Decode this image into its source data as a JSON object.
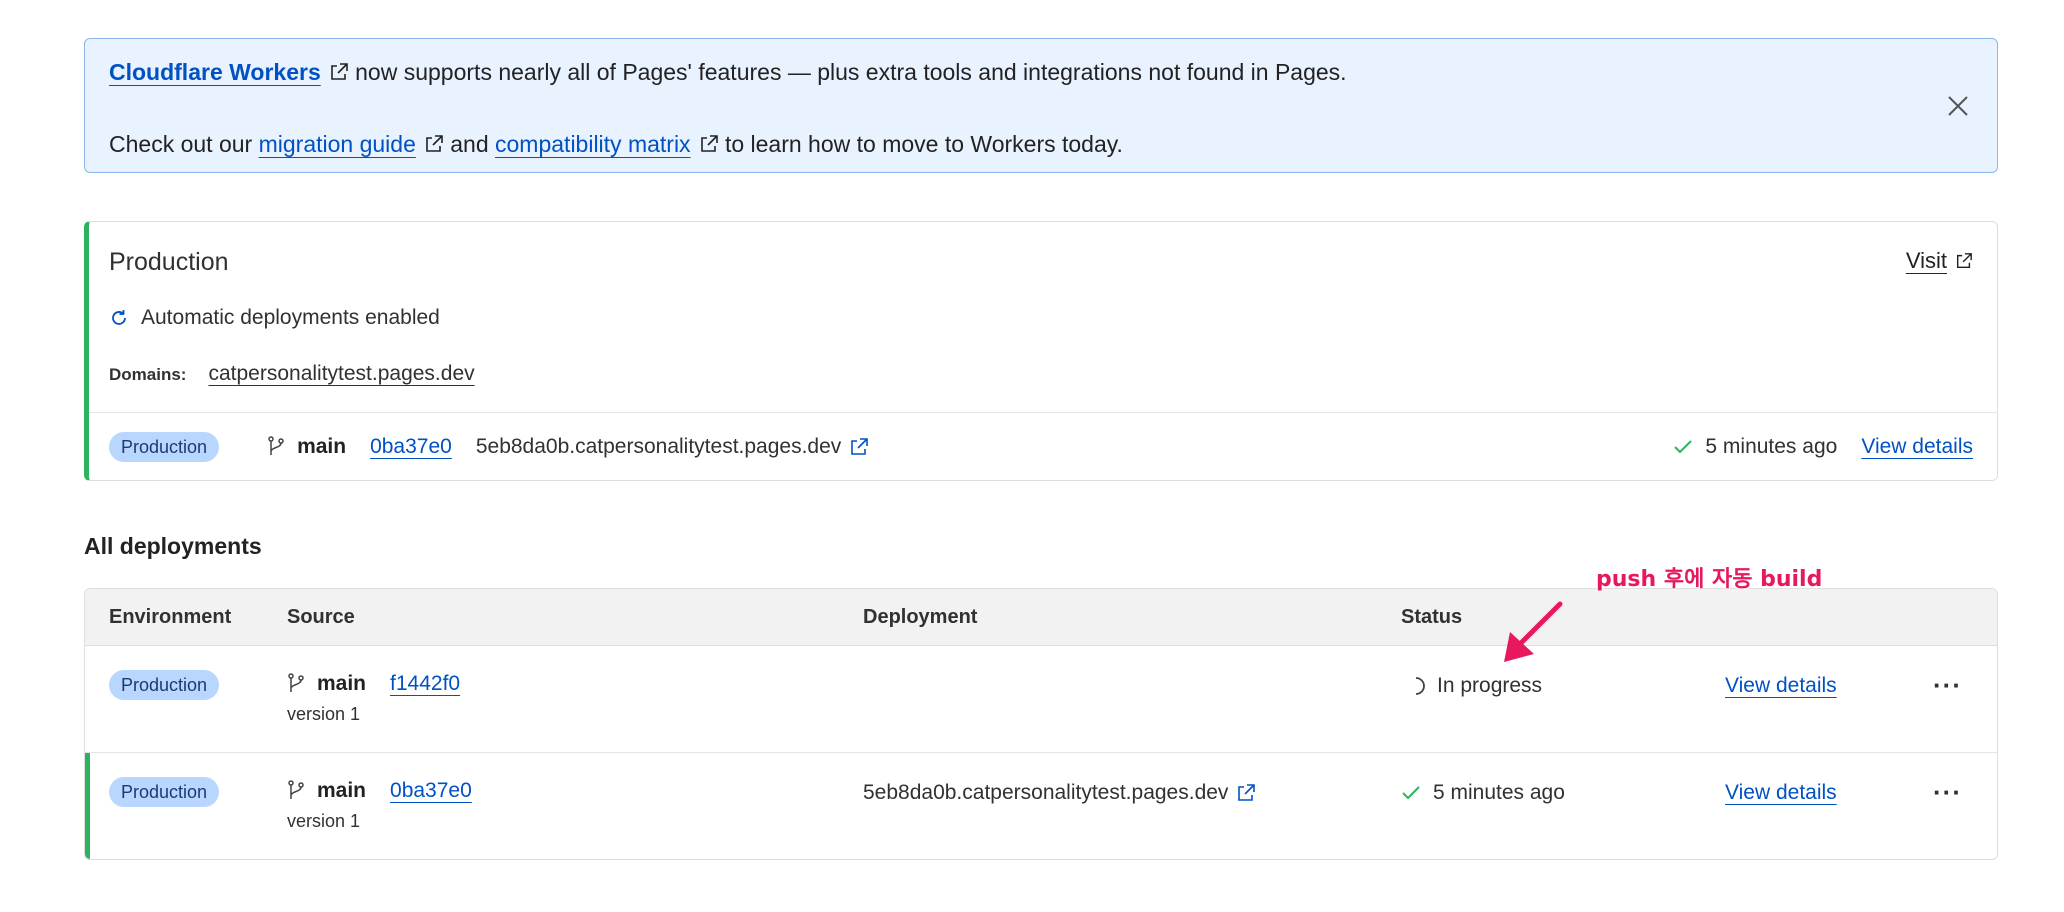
{
  "banner": {
    "workers_link": "Cloudflare Workers",
    "line1_rest": "now supports nearly all of Pages' features — plus extra tools and integrations not found in Pages.",
    "line2_prefix": "Check out our",
    "migration_link": "migration guide",
    "and": "and",
    "compat_link": "compatibility matrix",
    "line2_suffix": "to learn how to move to Workers today."
  },
  "production": {
    "title": "Production",
    "visit_label": "Visit",
    "auto_deploy": "Automatic deployments enabled",
    "domains_label": "Domains:",
    "domain": "catpersonalitytest.pages.dev",
    "env_badge": "Production",
    "branch": "main",
    "commit": "0ba37e0",
    "deployment_url": "5eb8da0b.catpersonalitytest.pages.dev",
    "time": "5 minutes ago",
    "view_details": "View details"
  },
  "all_deployments": {
    "title": "All deployments",
    "columns": [
      "Environment",
      "Source",
      "Deployment",
      "Status"
    ],
    "rows": [
      {
        "env": "Production",
        "branch": "main",
        "commit": "f1442f0",
        "version": "version 1",
        "deployment_url": "",
        "status": "In progress",
        "view_details": "View details",
        "more": "···"
      },
      {
        "env": "Production",
        "branch": "main",
        "commit": "0ba37e0",
        "version": "version 1",
        "deployment_url": "5eb8da0b.catpersonalitytest.pages.dev",
        "status": "5 minutes ago",
        "view_details": "View details",
        "more": "···"
      }
    ]
  },
  "annotation": {
    "text": "push 후에 자동 build",
    "color": "#e8185e"
  },
  "colors": {
    "link": "#0051c3",
    "success": "#2db35d",
    "banner_bg": "#e9f2ff",
    "badge_bg": "#b9d6ff"
  }
}
